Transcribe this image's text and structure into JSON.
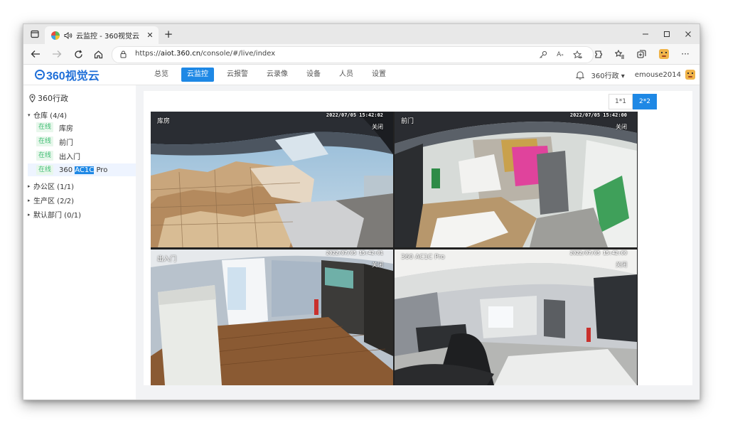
{
  "browser": {
    "tab_title": "云监控 - 360视觉云",
    "url_prefix": "https://",
    "url_host": "aiot.360.cn",
    "url_path": "/console/#/live/index"
  },
  "app": {
    "logo": "360视觉云",
    "nav": [
      "总览",
      "云监控",
      "云报警",
      "云录像",
      "设备",
      "人员",
      "设置"
    ],
    "org": "360行政 ▾",
    "user": "emouse2014"
  },
  "sidebar": {
    "root": "360行政",
    "groups": [
      {
        "label": "仓库 (4/4)",
        "caret": "▾"
      },
      {
        "label": "办公区 (1/1)",
        "caret": "▸"
      },
      {
        "label": "生产区 (2/2)",
        "caret": "▸"
      },
      {
        "label": "默认部门 (0/1)",
        "caret": "▸"
      }
    ],
    "devices": [
      {
        "status": "在线",
        "name": "库房"
      },
      {
        "status": "在线",
        "name": "前门"
      },
      {
        "status": "在线",
        "name": "出入门"
      },
      {
        "status": "在线",
        "name_pre": "360 ",
        "name_hl": "AC1C",
        "name_post": " Pro"
      }
    ]
  },
  "layout_options": [
    "1*1",
    "2*2"
  ],
  "cameras": [
    {
      "name": "库房",
      "timestamp": "2022/07/05 15:42:02",
      "close": "关闭"
    },
    {
      "name": "前门",
      "timestamp": "2022/07/05 15:42:00",
      "close": "关闭"
    },
    {
      "name": "出入门",
      "timestamp": "2022/07/05 15:42:01",
      "close": "关闭"
    },
    {
      "name": "360 AC1C Pro",
      "timestamp": "2022/07/05 15:42:00",
      "close": "关闭"
    }
  ]
}
